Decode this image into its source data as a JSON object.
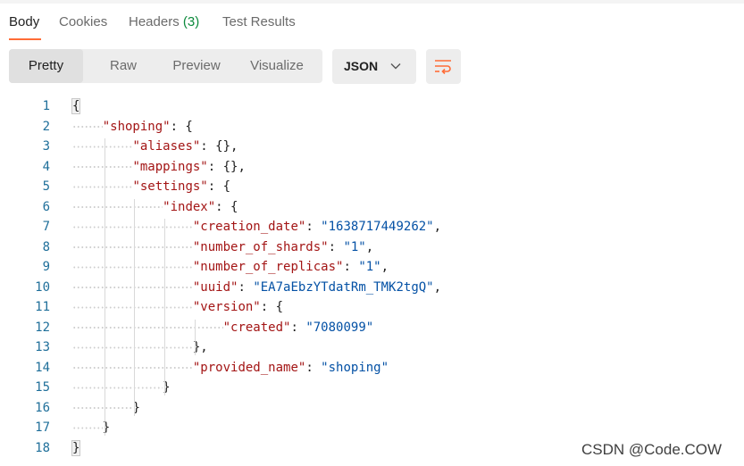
{
  "tabs": [
    {
      "label": "Body",
      "active": true
    },
    {
      "label": "Cookies",
      "active": false
    },
    {
      "label": "Headers ",
      "count": "(3)",
      "active": false
    },
    {
      "label": "Test Results",
      "active": false
    }
  ],
  "view_modes": [
    "Pretty",
    "Raw",
    "Preview",
    "Visualize"
  ],
  "active_view_mode": "Pretty",
  "format_select": {
    "value": "JSON",
    "icon": "chevron-down-icon"
  },
  "wrap_button": {
    "icon": "wrap-lines-icon"
  },
  "colors": {
    "accent": "#ff6c37",
    "count": "#0c8a3c",
    "json_key": "#a31515",
    "json_string": "#0451a5",
    "line_number": "#1f6f9a"
  },
  "line_numbers": [
    "1",
    "2",
    "3",
    "4",
    "5",
    "6",
    "7",
    "8",
    "9",
    "10",
    "11",
    "12",
    "13",
    "14",
    "15",
    "16",
    "17",
    "18"
  ],
  "code_lines": [
    {
      "indent": 0,
      "tokens": [
        {
          "t": "pun",
          "v": "{"
        }
      ]
    },
    {
      "indent": 1,
      "tokens": [
        {
          "t": "key",
          "v": "\"shoping\""
        },
        {
          "t": "pun",
          "v": ": {"
        }
      ]
    },
    {
      "indent": 2,
      "tokens": [
        {
          "t": "key",
          "v": "\"aliases\""
        },
        {
          "t": "pun",
          "v": ": {},"
        }
      ]
    },
    {
      "indent": 2,
      "tokens": [
        {
          "t": "key",
          "v": "\"mappings\""
        },
        {
          "t": "pun",
          "v": ": {},"
        }
      ]
    },
    {
      "indent": 2,
      "tokens": [
        {
          "t": "key",
          "v": "\"settings\""
        },
        {
          "t": "pun",
          "v": ": {"
        }
      ]
    },
    {
      "indent": 3,
      "tokens": [
        {
          "t": "key",
          "v": "\"index\""
        },
        {
          "t": "pun",
          "v": ": {"
        }
      ]
    },
    {
      "indent": 4,
      "tokens": [
        {
          "t": "key",
          "v": "\"creation_date\""
        },
        {
          "t": "pun",
          "v": ": "
        },
        {
          "t": "str",
          "v": "\"1638717449262\""
        },
        {
          "t": "pun",
          "v": ","
        }
      ]
    },
    {
      "indent": 4,
      "tokens": [
        {
          "t": "key",
          "v": "\"number_of_shards\""
        },
        {
          "t": "pun",
          "v": ": "
        },
        {
          "t": "str",
          "v": "\"1\""
        },
        {
          "t": "pun",
          "v": ","
        }
      ]
    },
    {
      "indent": 4,
      "tokens": [
        {
          "t": "key",
          "v": "\"number_of_replicas\""
        },
        {
          "t": "pun",
          "v": ": "
        },
        {
          "t": "str",
          "v": "\"1\""
        },
        {
          "t": "pun",
          "v": ","
        }
      ]
    },
    {
      "indent": 4,
      "tokens": [
        {
          "t": "key",
          "v": "\"uuid\""
        },
        {
          "t": "pun",
          "v": ": "
        },
        {
          "t": "str",
          "v": "\"EA7aEbzYTdatRm_TMK2tgQ\""
        },
        {
          "t": "pun",
          "v": ","
        }
      ]
    },
    {
      "indent": 4,
      "tokens": [
        {
          "t": "key",
          "v": "\"version\""
        },
        {
          "t": "pun",
          "v": ": {"
        }
      ]
    },
    {
      "indent": 5,
      "tokens": [
        {
          "t": "key",
          "v": "\"created\""
        },
        {
          "t": "pun",
          "v": ": "
        },
        {
          "t": "str",
          "v": "\"7080099\""
        }
      ]
    },
    {
      "indent": 4,
      "tokens": [
        {
          "t": "pun",
          "v": "},"
        }
      ]
    },
    {
      "indent": 4,
      "tokens": [
        {
          "t": "key",
          "v": "\"provided_name\""
        },
        {
          "t": "pun",
          "v": ": "
        },
        {
          "t": "str",
          "v": "\"shoping\""
        }
      ]
    },
    {
      "indent": 3,
      "tokens": [
        {
          "t": "pun",
          "v": "}"
        }
      ]
    },
    {
      "indent": 2,
      "tokens": [
        {
          "t": "pun",
          "v": "}"
        }
      ]
    },
    {
      "indent": 1,
      "tokens": [
        {
          "t": "pun",
          "v": "}"
        }
      ]
    },
    {
      "indent": 0,
      "tokens": [
        {
          "t": "pun",
          "v": "}"
        }
      ]
    }
  ],
  "watermark": "CSDN @Code.COW"
}
